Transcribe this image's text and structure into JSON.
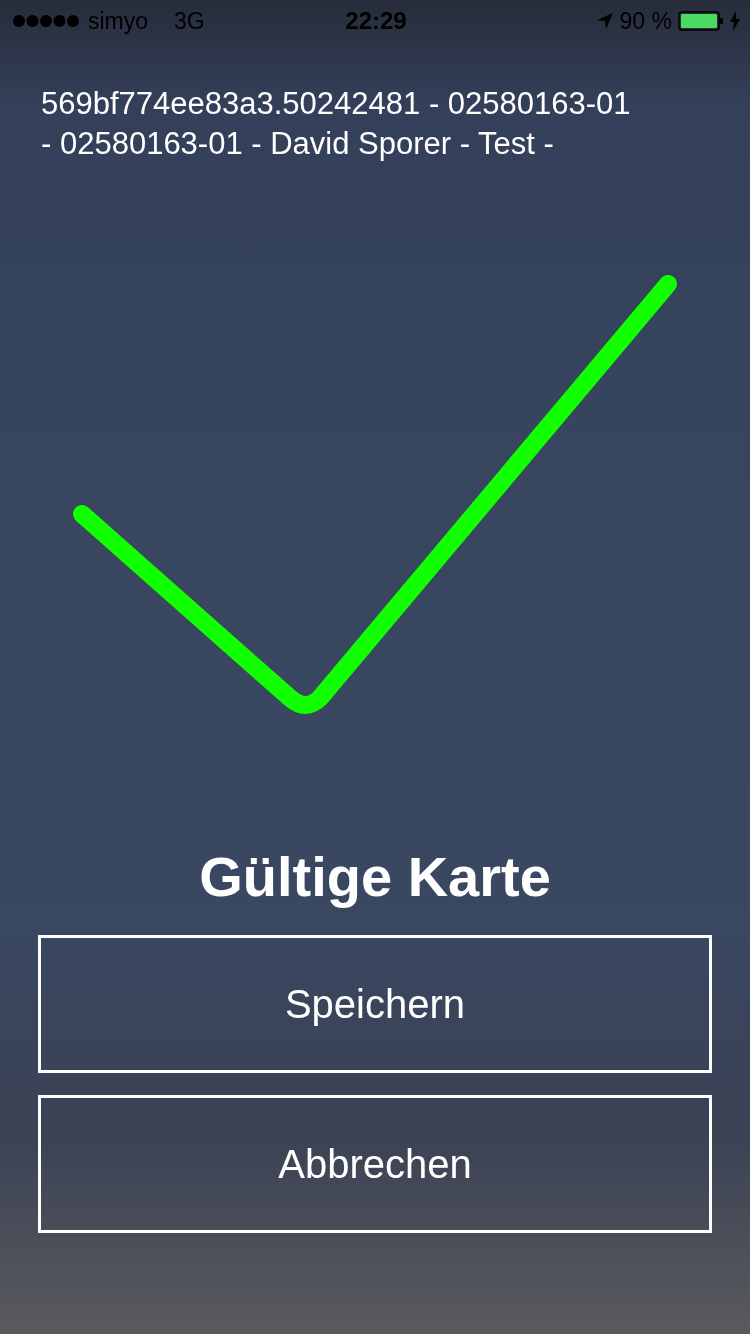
{
  "status_bar": {
    "carrier": "simyo",
    "network": "3G",
    "time": "22:29",
    "battery": "90 %",
    "charging": true
  },
  "card_info": "569bf774ee83a3.50242481 - 02580163-01 - 02580163-01 - David Sporer - Test -",
  "result": {
    "kind": "valid",
    "title": "Gültige Karte"
  },
  "buttons": [
    {
      "label": "Speichern"
    },
    {
      "label": "Abbrechen"
    }
  ]
}
